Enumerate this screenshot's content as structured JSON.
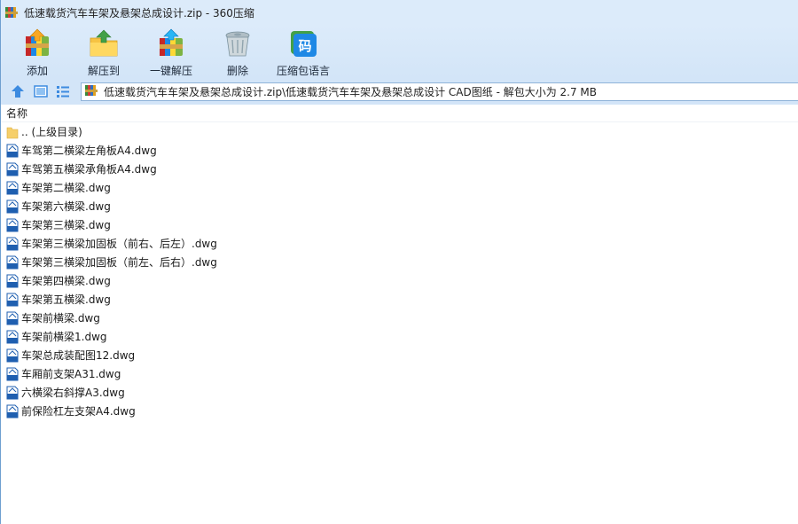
{
  "window": {
    "title": "低速载货汽车车架及悬架总成设计.zip - 360压缩"
  },
  "toolbar": {
    "buttons": [
      {
        "label": "添加",
        "icon": "add-archive-icon"
      },
      {
        "label": "解压到",
        "icon": "extract-to-icon"
      },
      {
        "label": "一键解压",
        "icon": "one-click-extract-icon"
      },
      {
        "label": "删除",
        "icon": "trash-icon"
      },
      {
        "label": "压缩包语言",
        "icon": "archive-language-icon"
      }
    ]
  },
  "address": {
    "path": "低速载货汽车车架及悬架总成设计.zip\\低速载货汽车车架及悬架总成设计 CAD图纸 - 解包大小为 2.7 MB"
  },
  "list": {
    "column_name": "名称",
    "items": [
      {
        "name": ".. (上级目录)",
        "type": "folder"
      },
      {
        "name": "车驾第二横梁左角板A4.dwg",
        "type": "dwg"
      },
      {
        "name": "车驾第五横梁承角板A4.dwg",
        "type": "dwg"
      },
      {
        "name": "车架第二横梁.dwg",
        "type": "dwg"
      },
      {
        "name": "车架第六横梁.dwg",
        "type": "dwg"
      },
      {
        "name": "车架第三横梁.dwg",
        "type": "dwg"
      },
      {
        "name": "车架第三横梁加固板（前右、后左）.dwg",
        "type": "dwg"
      },
      {
        "name": "车架第三横梁加固板（前左、后右）.dwg",
        "type": "dwg"
      },
      {
        "name": "车架第四横梁.dwg",
        "type": "dwg"
      },
      {
        "name": "车架第五横梁.dwg",
        "type": "dwg"
      },
      {
        "name": "车架前横梁.dwg",
        "type": "dwg"
      },
      {
        "name": "车架前横梁1.dwg",
        "type": "dwg"
      },
      {
        "name": "车架总成装配图12.dwg",
        "type": "dwg"
      },
      {
        "name": "车厢前支架A31.dwg",
        "type": "dwg"
      },
      {
        "name": "六横梁右斜撑A3.dwg",
        "type": "dwg"
      },
      {
        "name": "前保险杠左支架A4.dwg",
        "type": "dwg"
      }
    ]
  }
}
